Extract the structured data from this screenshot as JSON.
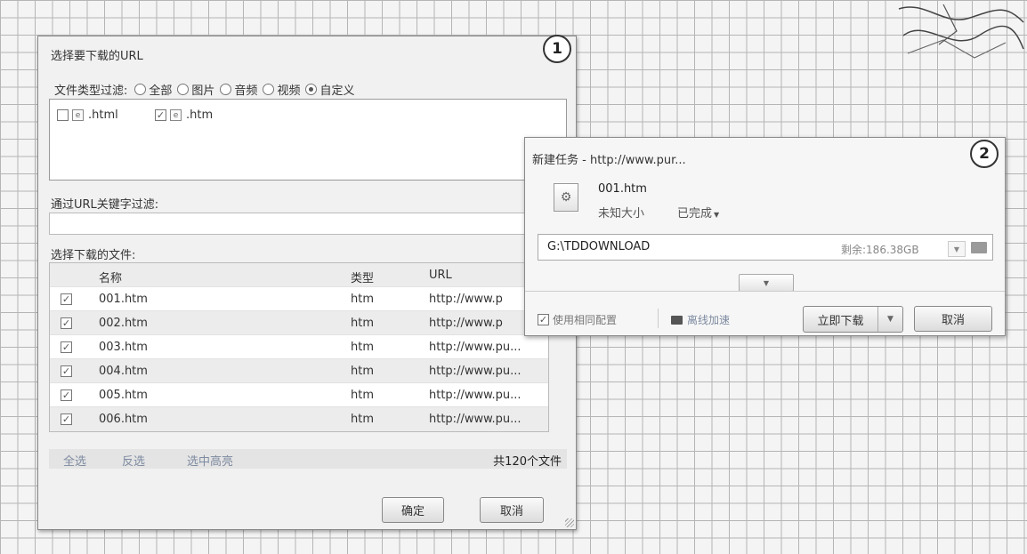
{
  "dialog1": {
    "title": "选择要下载的URL",
    "filter_label": "文件类型过滤:",
    "radio_options": [
      "全部",
      "图片",
      "音频",
      "视频",
      "自定义"
    ],
    "selected_option": "自定义",
    "extensions": [
      {
        "label": ".html",
        "checked": false
      },
      {
        "label": ".htm",
        "checked": true
      }
    ],
    "keyword_label": "通过URL关键字过滤:",
    "keyword_value": "",
    "files_label": "选择下载的文件:",
    "columns": {
      "name": "名称",
      "type": "类型",
      "url": "URL"
    },
    "rows": [
      {
        "name": "001.htm",
        "type": "htm",
        "url": "http://www.p",
        "checked": true
      },
      {
        "name": "002.htm",
        "type": "htm",
        "url": "http://www.p",
        "checked": true
      },
      {
        "name": "003.htm",
        "type": "htm",
        "url": "http://www.pu...",
        "checked": true
      },
      {
        "name": "004.htm",
        "type": "htm",
        "url": "http://www.pu...",
        "checked": true
      },
      {
        "name": "005.htm",
        "type": "htm",
        "url": "http://www.pu...",
        "checked": true
      },
      {
        "name": "006.htm",
        "type": "htm",
        "url": "http://www.pu...",
        "checked": true
      }
    ],
    "select_all": "全选",
    "invert": "反选",
    "highlight": "选中高亮",
    "count": "共120个文件",
    "ok": "确定",
    "cancel": "取消"
  },
  "dialog2": {
    "title": "新建任务 - http://www.pur...",
    "file_name": "001.htm",
    "file_size": "未知大小",
    "status": "已完成",
    "path": "G:\\TDDOWNLOAD",
    "free_space": "剩余:186.38GB",
    "same_config": "使用相同配置",
    "offline": "离线加速",
    "download_now": "立即下载",
    "cancel": "取消"
  },
  "markers": [
    "1",
    "2"
  ],
  "icons": {
    "check": "✓",
    "file": "file-icon",
    "folder": "folder-icon",
    "dropdown": "▼"
  }
}
